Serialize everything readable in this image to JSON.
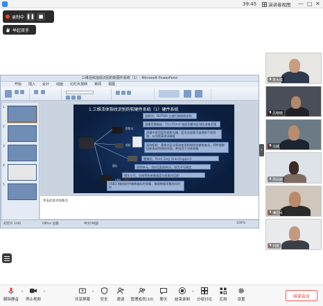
{
  "window": {
    "clock": "39:45",
    "view_mode": "演讲者视图",
    "controls": [
      "—",
      "□",
      "✕"
    ]
  },
  "recording": {
    "status": "录制中",
    "pause": "❚❚",
    "stop": "■"
  },
  "manage_button": "举起双手",
  "ppt": {
    "window_title": "三维活体指纹识别的软硬件系统（1）- Microsoft PowerPoint",
    "tabs": [
      "开始",
      "插入",
      "设计",
      "动画",
      "幻灯片放映",
      "审阅",
      "视图"
    ],
    "slide_title": "1.三维活体指纹识别的软硬件系统（1）硬件系统",
    "boxes": [
      "投影仪：DLP500 三维扫描相机定制",
      "测量范围指标：15×15mm 指纹测量的区域及成像范围",
      "测量中采用蓝色投影光栅，蓝光对皮肤可穿透的千扰性强，从而提高测试精度",
      "面阵相机：基线光区分条纹变形和指纹形貌的变化，同时提取投影条纹和指纹纹理，更适合于活体采集",
      "摄像机：Point Grey Grasshopper3",
      "照明单元，良好匹配结构光，较为平坦稳定",
      "镜头小巧，分辨率和采集速度与投影仪匹配",
      "USB3.0能较好传输数据实时采集，确保数据采集的实时性"
    ],
    "device_labels": [
      "投影仪",
      "相机",
      "镜头",
      "USB"
    ],
    "notes_placeholder": "单击此处添加备注",
    "status": [
      "幻灯片 1/40",
      "Office 主题",
      "中文(中国)",
      "100%"
    ]
  },
  "participants": [
    {
      "name": "李大成",
      "mic": "on"
    },
    {
      "name": "吕晓晓",
      "mic": "off"
    },
    {
      "name": "马威",
      "mic": "off"
    },
    {
      "name": "周凤娇",
      "mic": "on"
    },
    {
      "name": "潘国民",
      "mic": "off"
    },
    {
      "name": "刘斌",
      "mic": "off"
    }
  ],
  "toolbar": {
    "items": [
      {
        "label": "解除静音",
        "icon": "mic-icon"
      },
      {
        "label": "停止视频",
        "icon": "video-icon"
      },
      {
        "label": "共享屏幕",
        "icon": "share-screen-icon"
      },
      {
        "label": "安全",
        "icon": "shield-icon"
      },
      {
        "label": "邀请",
        "icon": "invite-icon"
      },
      {
        "label": "管理成员(10)",
        "icon": "members-icon"
      },
      {
        "label": "聊天",
        "icon": "chat-icon"
      },
      {
        "label": "结束录制",
        "icon": "record-icon"
      },
      {
        "label": "分组讨论",
        "icon": "breakout-icon"
      },
      {
        "label": "应用",
        "icon": "apps-icon"
      },
      {
        "label": "设置",
        "icon": "gear-icon"
      }
    ],
    "leave": "结束会议"
  },
  "colors": {
    "accent_red": "#e53935",
    "slide_bg": "#0b1e3e",
    "box_fill": "#9fb4d6"
  }
}
